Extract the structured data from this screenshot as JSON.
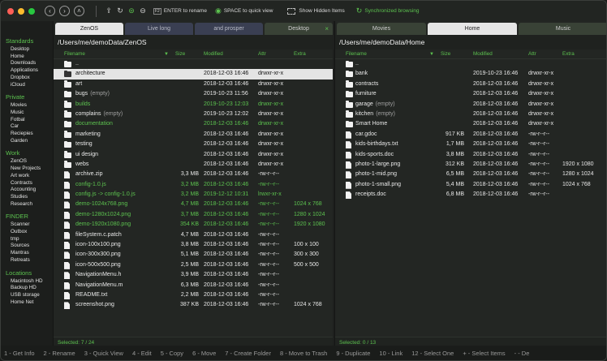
{
  "toolbar": {
    "rename_key": "F2",
    "rename_label": "ENTER to rename",
    "quickview_label": "SPACE to quick view",
    "hidden_label": "Show Hidden Items",
    "sync_label": "Synchronized browsing"
  },
  "sidebar": {
    "sections": [
      {
        "title": "Standards",
        "items": [
          "Desktop",
          "Home",
          "Downloads",
          "Applications",
          "Dropbox",
          "iCloud"
        ]
      },
      {
        "title": "Private",
        "items": [
          "Movies",
          "Music",
          "Fotbal",
          "Car",
          "Reciepies",
          "Garden"
        ]
      },
      {
        "title": "Work",
        "items": [
          "ZenOS",
          "New Projects",
          "Art work",
          "Contracts",
          "Accounting",
          "Studies",
          "Research"
        ]
      },
      {
        "title": "FINDER",
        "items": [
          "Scanner",
          "Outbox",
          "tmp",
          "Sources",
          "Mantras",
          "Retreats"
        ]
      },
      {
        "title": "Locations",
        "items": [
          "Macintosh HD",
          "Backup HD",
          "USB storage",
          "Home Net"
        ]
      }
    ]
  },
  "left": {
    "tabs": [
      "ZenOS",
      "Live long",
      "and prosper",
      "Desktop"
    ],
    "path": "/Users/me/demoData/ZenOS",
    "columns": {
      "name": "Filename",
      "size": "Size",
      "modified": "Modified",
      "attr": "Attr",
      "extra": "Extra"
    },
    "rows": [
      {
        "type": "folder",
        "name": "..",
        "size": "",
        "modified": "",
        "attr": "",
        "extra": "",
        "color": "white"
      },
      {
        "type": "folder",
        "name": "architecture",
        "size": "",
        "modified": "2018-12-03 16:46",
        "attr": "drwxr-xr-x",
        "extra": "",
        "color": "hl"
      },
      {
        "type": "folder",
        "name": "art",
        "size": "",
        "modified": "2018-12-03 16:46",
        "attr": "drwxr-xr-x",
        "extra": "",
        "color": "white"
      },
      {
        "type": "folder",
        "name": "bugs",
        "note": "(empty)",
        "size": "",
        "modified": "2019-10-23 11:56",
        "attr": "drwxr-xr-x",
        "extra": "",
        "color": "white"
      },
      {
        "type": "folder",
        "name": "builds",
        "size": "",
        "modified": "2019-10-23 12:03",
        "attr": "drwxr-xr-x",
        "extra": "",
        "color": "green"
      },
      {
        "type": "folder",
        "name": "complains",
        "note": "(empty)",
        "size": "",
        "modified": "2019-10-23 12:02",
        "attr": "drwxr-xr-x",
        "extra": "",
        "color": "white"
      },
      {
        "type": "folder",
        "name": "documentation",
        "size": "",
        "modified": "2018-12-03 16:46",
        "attr": "drwxr-xr-x",
        "extra": "",
        "color": "green"
      },
      {
        "type": "folder",
        "name": "marketing",
        "size": "",
        "modified": "2018-12-03 16:46",
        "attr": "drwxr-xr-x",
        "extra": "",
        "color": "white"
      },
      {
        "type": "folder",
        "name": "testing",
        "size": "",
        "modified": "2018-12-03 16:46",
        "attr": "drwxr-xr-x",
        "extra": "",
        "color": "white"
      },
      {
        "type": "folder",
        "name": "ui design",
        "size": "",
        "modified": "2018-12-03 16:46",
        "attr": "drwxr-xr-x",
        "extra": "",
        "color": "white"
      },
      {
        "type": "folder",
        "name": "webs",
        "size": "",
        "modified": "2018-12-03 16:46",
        "attr": "drwxr-xr-x",
        "extra": "",
        "color": "white"
      },
      {
        "type": "file",
        "name": "archive.zip",
        "size": "3,3 MB",
        "modified": "2018-12-03 16:46",
        "attr": "-rw-r--r--",
        "extra": "",
        "color": "white"
      },
      {
        "type": "file",
        "name": "config-1.0.js",
        "size": "3,2 MB",
        "modified": "2018-12-03 16:46",
        "attr": "-rw-r--r--",
        "extra": "",
        "color": "green"
      },
      {
        "type": "file",
        "name": "config.js -> config-1.0.js",
        "size": "3,2 MB",
        "modified": "2019-12-12 10:31",
        "attr": "lrwxr-xr-x",
        "extra": "",
        "color": "green"
      },
      {
        "type": "file",
        "name": "demo-1024x768.png",
        "size": "4,7 MB",
        "modified": "2018-12-03 16:46",
        "attr": "-rw-r--r--",
        "extra": "1024 x 768",
        "color": "green"
      },
      {
        "type": "file",
        "name": "demo-1280x1024.png",
        "size": "3,7 MB",
        "modified": "2018-12-03 16:46",
        "attr": "-rw-r--r--",
        "extra": "1280 x 1024",
        "color": "green"
      },
      {
        "type": "file",
        "name": "demo-1920x1080.png",
        "size": "354 KB",
        "modified": "2018-12-03 16:46",
        "attr": "-rw-r--r--",
        "extra": "1920 x 1080",
        "color": "green"
      },
      {
        "type": "file",
        "name": "fileSystem.c.patch",
        "size": "4,7 MB",
        "modified": "2018-12-03 16:46",
        "attr": "-rw-r--r--",
        "extra": "",
        "color": "white"
      },
      {
        "type": "file",
        "name": "icon-100x100.png",
        "size": "3,8 MB",
        "modified": "2018-12-03 16:46",
        "attr": "-rw-r--r--",
        "extra": "100 x 100",
        "color": "white"
      },
      {
        "type": "file",
        "name": "icon-300x300.png",
        "size": "5,1 MB",
        "modified": "2018-12-03 16:46",
        "attr": "-rw-r--r--",
        "extra": "300 x 300",
        "color": "white"
      },
      {
        "type": "file",
        "name": "icon-500x500.png",
        "size": "2,5 MB",
        "modified": "2018-12-03 16:46",
        "attr": "-rw-r--r--",
        "extra": "500 x 500",
        "color": "white"
      },
      {
        "type": "file",
        "name": "NavigationMenu.h",
        "size": "3,9 MB",
        "modified": "2018-12-03 16:46",
        "attr": "-rw-r--r--",
        "extra": "",
        "color": "white"
      },
      {
        "type": "file",
        "name": "NavigationMenu.m",
        "size": "6,3 MB",
        "modified": "2018-12-03 16:46",
        "attr": "-rw-r--r--",
        "extra": "",
        "color": "white"
      },
      {
        "type": "file",
        "name": "README.txt",
        "size": "2,2 MB",
        "modified": "2018-12-03 16:46",
        "attr": "-rw-r--r--",
        "extra": "",
        "color": "white"
      },
      {
        "type": "file",
        "name": "screenshot.png",
        "size": "387 KB",
        "modified": "2018-12-03 16:46",
        "attr": "-rw-r--r--",
        "extra": "1024 x 768",
        "color": "white"
      }
    ],
    "status": "Selected: 7 / 24"
  },
  "right": {
    "tabs": [
      "Movies",
      "Home",
      "Music"
    ],
    "path": "/Users/me/demoData/Home",
    "columns": {
      "name": "Filename",
      "size": "Size",
      "modified": "Modified",
      "attr": "Attr",
      "extra": "Extra"
    },
    "rows": [
      {
        "type": "folder",
        "name": "..",
        "size": "",
        "modified": "",
        "attr": "",
        "extra": "",
        "color": "white"
      },
      {
        "type": "folder",
        "name": "bank",
        "size": "",
        "modified": "2019-10-23 16:46",
        "attr": "drwxr-xr-x",
        "extra": "",
        "color": "white"
      },
      {
        "type": "folder",
        "name": "contracts",
        "size": "",
        "modified": "2018-12-03 16:46",
        "attr": "drwxr-xr-x",
        "extra": "",
        "color": "white"
      },
      {
        "type": "folder",
        "name": "furniture",
        "size": "",
        "modified": "2018-12-03 16:46",
        "attr": "drwxr-xr-x",
        "extra": "",
        "color": "white"
      },
      {
        "type": "folder",
        "name": "garage",
        "note": "(empty)",
        "size": "",
        "modified": "2018-12-03 16:46",
        "attr": "drwxr-xr-x",
        "extra": "",
        "color": "white"
      },
      {
        "type": "folder",
        "name": "kitchen",
        "note": "(empty)",
        "size": "",
        "modified": "2018-12-03 16:46",
        "attr": "drwxr-xr-x",
        "extra": "",
        "color": "white"
      },
      {
        "type": "folder",
        "name": "Smart Home",
        "size": "",
        "modified": "2018-12-03 16:46",
        "attr": "drwxr-xr-x",
        "extra": "",
        "color": "white"
      },
      {
        "type": "file",
        "name": "car.gdoc",
        "size": "917 KB",
        "modified": "2018-12-03 16:46",
        "attr": "-rw-r--r--",
        "extra": "",
        "color": "white"
      },
      {
        "type": "file",
        "name": "kids-birthdays.txt",
        "size": "1,7 MB",
        "modified": "2018-12-03 16:46",
        "attr": "-rw-r--r--",
        "extra": "",
        "color": "white"
      },
      {
        "type": "file",
        "name": "kids-sports.doc",
        "size": "3,8 MB",
        "modified": "2018-12-03 16:46",
        "attr": "-rw-r--r--",
        "extra": "",
        "color": "white"
      },
      {
        "type": "file",
        "name": "photo-1-large.png",
        "size": "312 KB",
        "modified": "2018-12-03 16:46",
        "attr": "-rw-r--r--",
        "extra": "1920 x 1080",
        "color": "white"
      },
      {
        "type": "file",
        "name": "photo-1-mid.png",
        "size": "6,5 MB",
        "modified": "2018-12-03 16:46",
        "attr": "-rw-r--r--",
        "extra": "1280 x 1024",
        "color": "white"
      },
      {
        "type": "file",
        "name": "photo-1-small.png",
        "size": "5,4 MB",
        "modified": "2018-12-03 16:46",
        "attr": "-rw-r--r--",
        "extra": "1024 x 768",
        "color": "white"
      },
      {
        "type": "file",
        "name": "receipts.doc",
        "size": "6,8 MB",
        "modified": "2018-12-03 16:46",
        "attr": "-rw-r--r--",
        "extra": "",
        "color": "white"
      }
    ],
    "status": "Selected: 0 / 13"
  },
  "fkeys": [
    "1 - Get Info",
    "2 - Rename",
    "3 - Quick View",
    "4 - Edit",
    "5 - Copy",
    "6 - Move",
    "7 - Create Folder",
    "8 - Move to Trash",
    "9 - Duplicate",
    "10 - Link",
    "12 - Select One",
    "+ - Select Items",
    "- - De"
  ],
  "colors": {
    "accent": "#5cc24f",
    "highlight": "#e4e4e4",
    "tab_inactive": "#3a3f52"
  }
}
